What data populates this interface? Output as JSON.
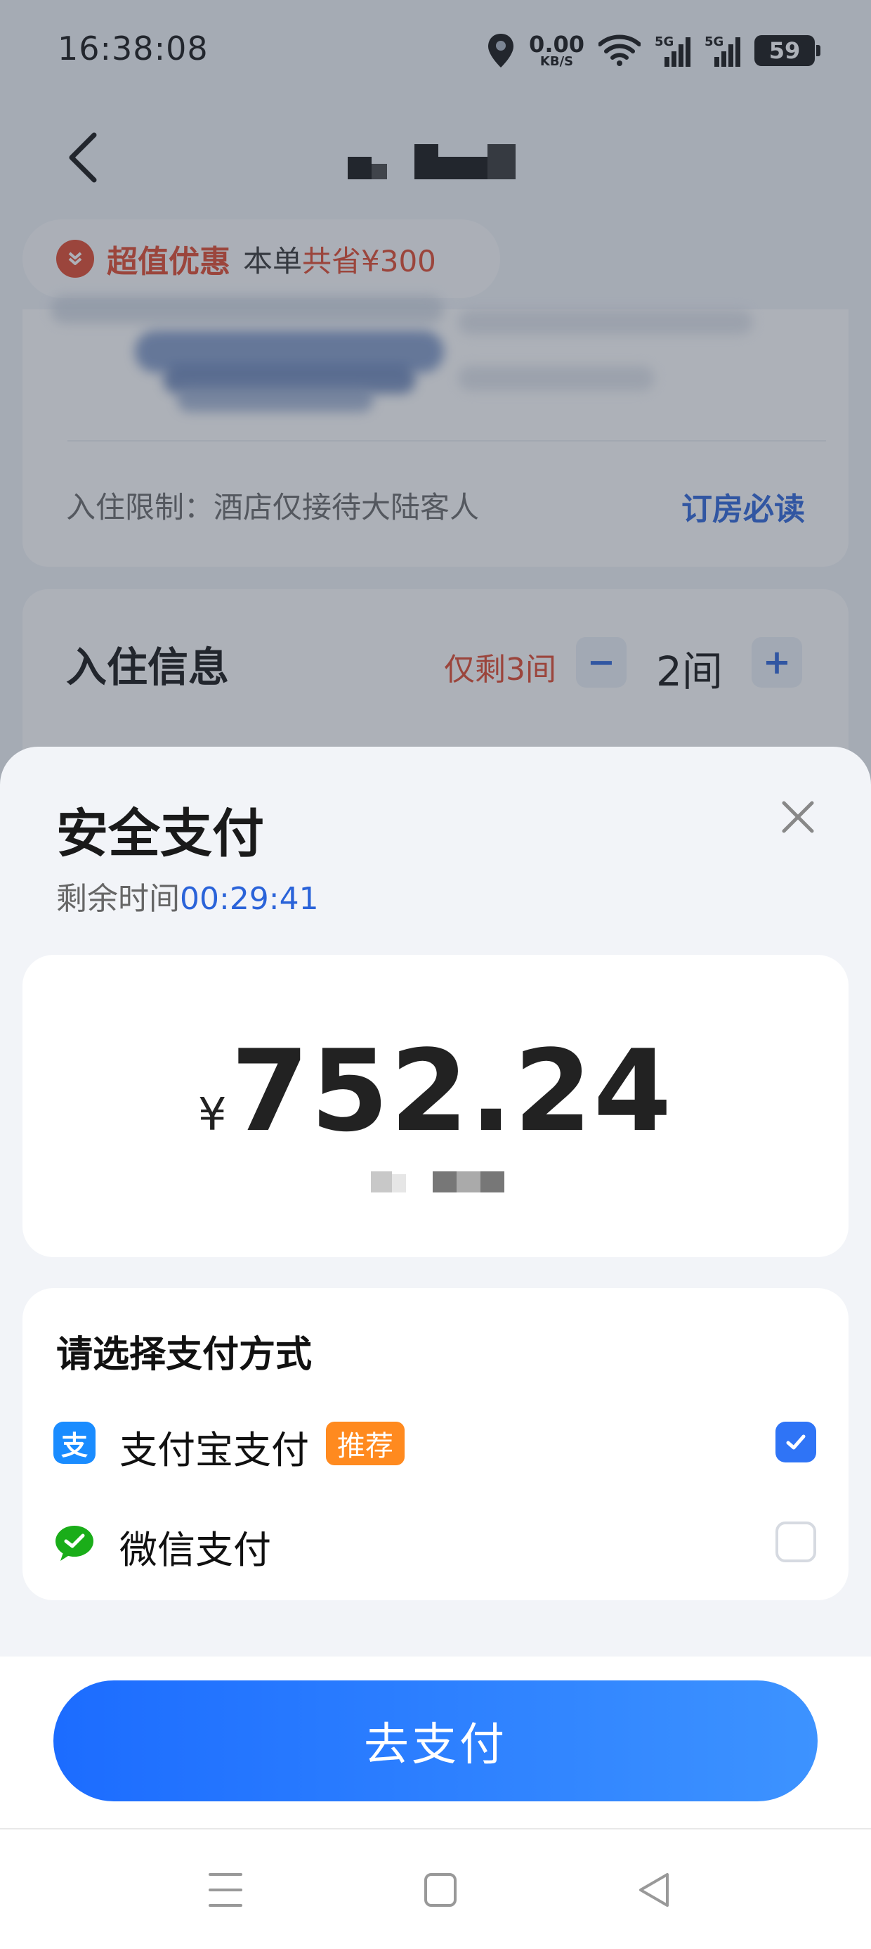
{
  "status_bar": {
    "time": "16:38:08",
    "speed_value": "0.00",
    "speed_unit": "KB/S",
    "signal_1_label": "5G",
    "signal_2_label": "5G",
    "battery": "59"
  },
  "background": {
    "promo": {
      "label": "超值优惠",
      "text": "本单",
      "amount_text": "共省¥300"
    },
    "checkin_limit": "入住限制：酒店仅接待大陆客人",
    "must_read": "订房必读",
    "checkin_title": "入住信息",
    "rooms_left": "仅剩3间",
    "minus_label": "−",
    "plus_label": "+",
    "room_count": "2间"
  },
  "sheet": {
    "title": "安全支付",
    "timer_label": "剩余时间",
    "timer_value": "00:29:41",
    "currency": "¥",
    "amount": "752.24",
    "method_heading": "请选择支付方式",
    "methods": [
      {
        "name": "支付宝支付",
        "badge": "推荐",
        "icon": "alipay-icon",
        "color": "#1a8cff",
        "glyph": "支",
        "selected": true
      },
      {
        "name": "微信支付",
        "icon": "wechat-icon",
        "color": "#1aad19",
        "selected": false
      }
    ],
    "pay_button": "去支付"
  },
  "colors": {
    "accent": "#2a63d9",
    "promo_red": "#e0462a",
    "badge_orange": "#ff8a1f",
    "checkbox_blue": "#2f74f6"
  }
}
